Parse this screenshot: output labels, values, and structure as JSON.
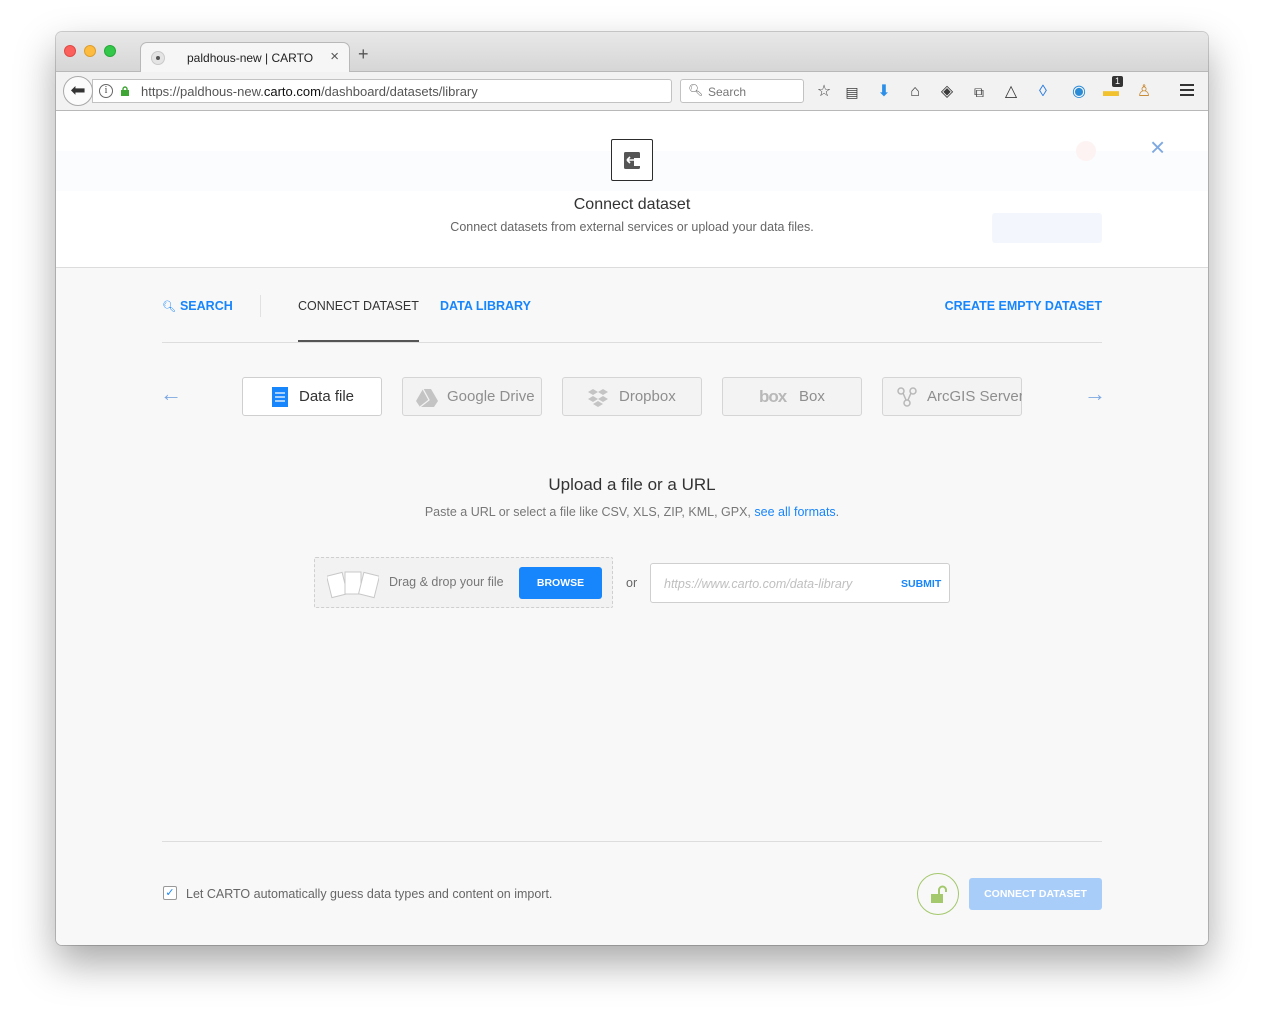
{
  "browser": {
    "tab_title": "paldhous-new | CARTO",
    "tab_close": "×",
    "new_tab": "+",
    "url_prefix": "https://paldhous-new.",
    "url_domain": "carto.com",
    "url_path": "/dashboard/datasets/library",
    "search_placeholder": "Search",
    "badge_count": "1",
    "icons": [
      "back-icon",
      "info-icon",
      "lock-icon",
      "reload-icon",
      "search-icon",
      "bookmark-star-icon",
      "reading-list-icon",
      "download-icon",
      "home-icon",
      "pocket-icon",
      "clipboard-icon",
      "triangle-icon",
      "drop-icon",
      "ring-icon",
      "extension-icon",
      "privacy-icon",
      "menu-icon"
    ]
  },
  "modal": {
    "title": "Connect dataset",
    "subtitle": "Connect datasets from external services or upload your data files.",
    "close": "×"
  },
  "nav": {
    "search": "SEARCH",
    "connect": "CONNECT DATASET",
    "library": "DATA LIBRARY",
    "create": "CREATE EMPTY DATASET"
  },
  "services": [
    {
      "label": "Data file",
      "icon": "document-icon",
      "active": true
    },
    {
      "label": "Google Drive",
      "icon": "google-drive-icon",
      "active": false
    },
    {
      "label": "Dropbox",
      "icon": "dropbox-icon",
      "active": false
    },
    {
      "label": "Box",
      "icon": "box-icon",
      "active": false
    },
    {
      "label": "ArcGIS Server™",
      "icon": "arcgis-icon",
      "active": false
    }
  ],
  "upload": {
    "title": "Upload a file or a URL",
    "subtitle_prefix": "Paste a URL or select a file like CSV, XLS, ZIP, KML, GPX,",
    "formats_link": "see all formats",
    "subtitle_suffix": ".",
    "drop_label": "Drag & drop your file",
    "browse": "BROWSE",
    "or": "or",
    "url_placeholder": "https://www.carto.com/data-library",
    "submit": "SUBMIT"
  },
  "footer": {
    "checkbox_checked": true,
    "checkbox_label": "Let CARTO automatically guess data types and content on import.",
    "connect_button": "CONNECT DATASET"
  },
  "colors": {
    "accent": "#1785fb",
    "accent_disabled": "#a9cdf9",
    "lock_green": "#a4c86c"
  }
}
